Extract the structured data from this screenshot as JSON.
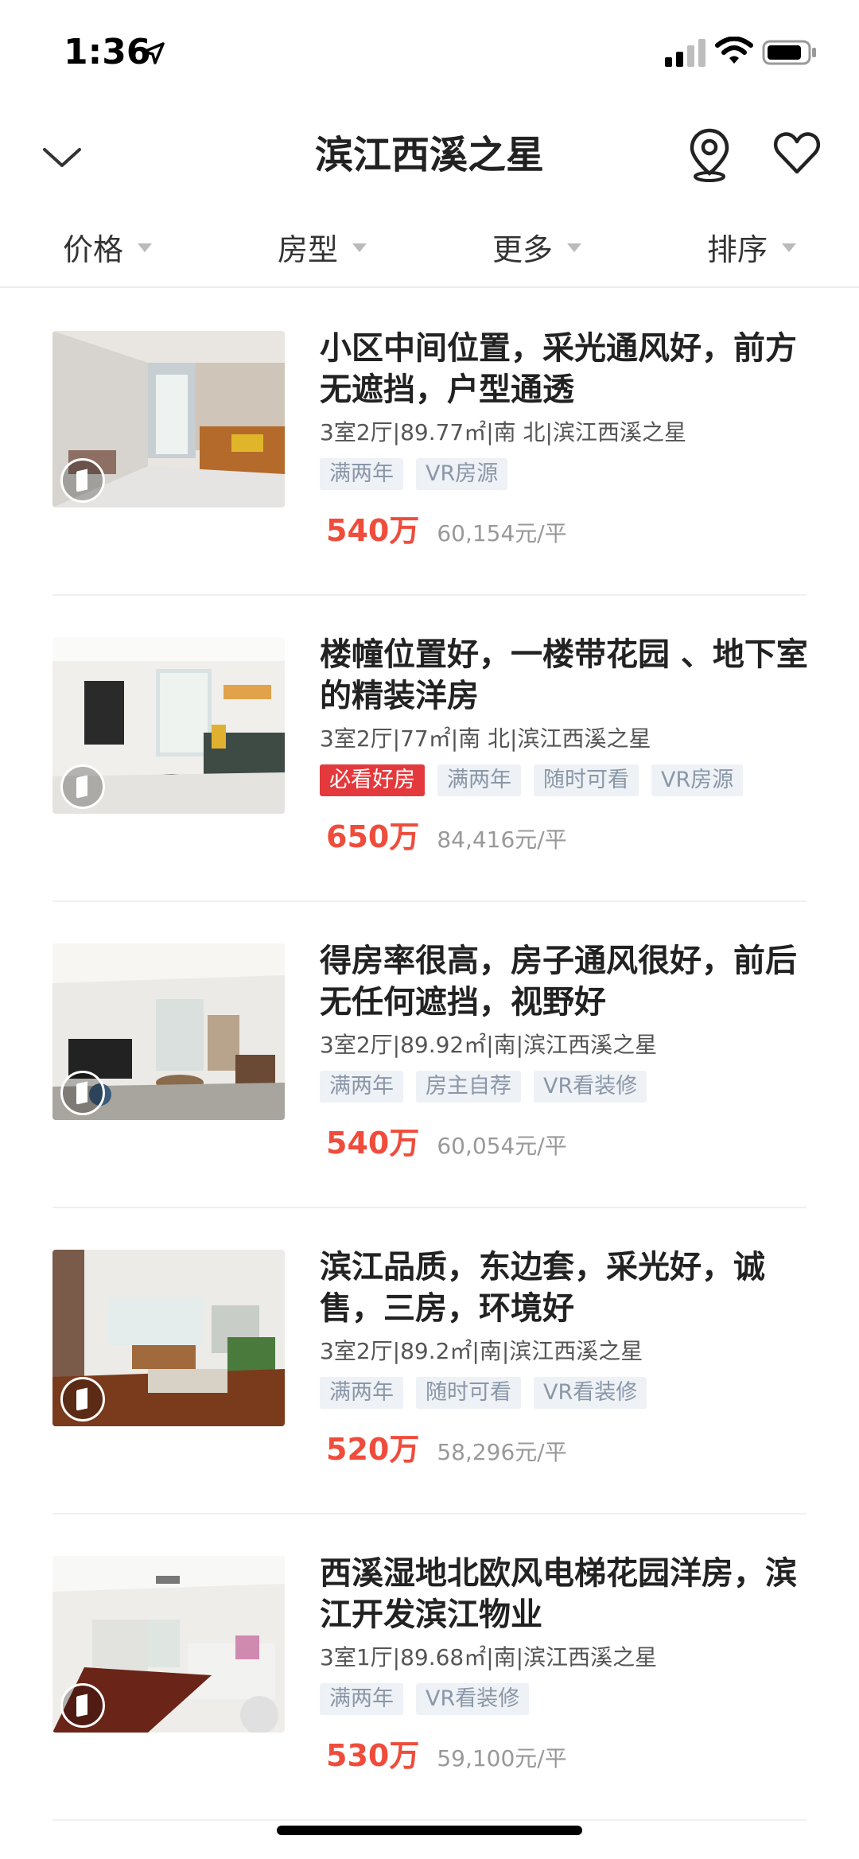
{
  "status": {
    "time": "1:36"
  },
  "header": {
    "title": "滨江西溪之星"
  },
  "filters": [
    {
      "label": "价格"
    },
    {
      "label": "房型"
    },
    {
      "label": "更多"
    },
    {
      "label": "排序"
    }
  ],
  "listings": [
    {
      "title": "小区中间位置，采光通风好，前方无遮挡，户型通透",
      "meta": "3室2厅|89.77㎡|南 北|滨江西溪之星",
      "tags": [
        "满两年",
        "VR房源"
      ],
      "price": "540万",
      "unit_price": "60,154元/平"
    },
    {
      "title": "楼幢位置好，一楼带花园 、地下室的精装洋房",
      "meta": "3室2厅|77㎡|南 北|滨江西溪之星",
      "tags": [
        "必看好房",
        "满两年",
        "随时可看",
        "VR房源"
      ],
      "price": "650万",
      "unit_price": "84,416元/平"
    },
    {
      "title": "得房率很高，房子通风很好，前后无任何遮挡，视野好",
      "meta": "3室2厅|89.92㎡|南|滨江西溪之星",
      "tags": [
        "满两年",
        "房主自荐",
        "VR看装修"
      ],
      "price": "540万",
      "unit_price": "60,054元/平"
    },
    {
      "title": "滨江品质，东边套，采光好，诚售，三房，环境好",
      "meta": "3室2厅|89.2㎡|南|滨江西溪之星",
      "tags": [
        "满两年",
        "随时可看",
        "VR看装修"
      ],
      "price": "520万",
      "unit_price": "58,296元/平"
    },
    {
      "title": "西溪湿地北欧风电梯花园洋房，滨江开发滨江物业",
      "meta": "3室1厅|89.68㎡|南|滨江西溪之星",
      "tags": [
        "满两年",
        "VR看装修"
      ],
      "price": "530万",
      "unit_price": "59,100元/平"
    }
  ],
  "colors": {
    "price": "#ef4c3c",
    "tag_bg": "#eef1f5",
    "tag_text": "#8a97a8",
    "hot_tag": "#e4393c"
  }
}
